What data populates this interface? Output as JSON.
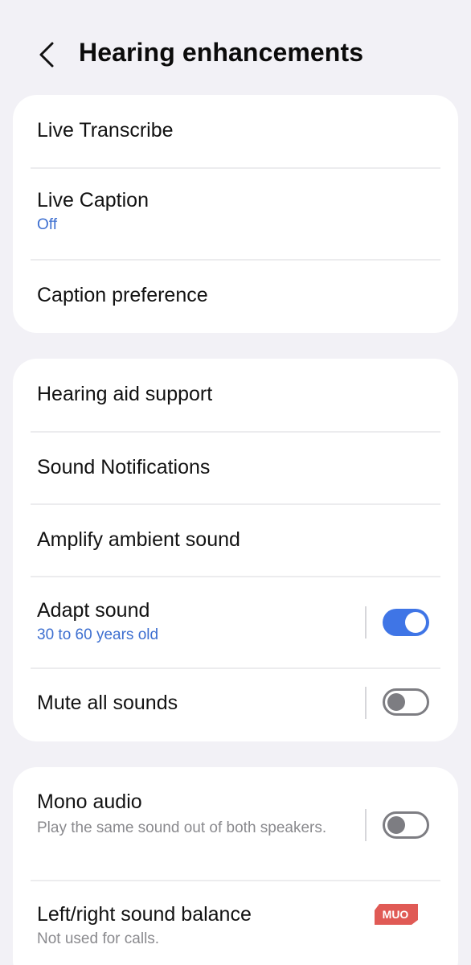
{
  "header": {
    "title": "Hearing enhancements",
    "back_icon": "chevron-left-icon"
  },
  "group1": {
    "live_transcribe": {
      "label": "Live Transcribe"
    },
    "live_caption": {
      "label": "Live Caption",
      "status": "Off"
    },
    "caption_preference": {
      "label": "Caption preference"
    }
  },
  "group2": {
    "hearing_aid_support": {
      "label": "Hearing aid support"
    },
    "sound_notifications": {
      "label": "Sound Notifications"
    },
    "amplify_ambient_sound": {
      "label": "Amplify ambient sound"
    },
    "adapt_sound": {
      "label": "Adapt sound",
      "status": "30 to 60 years old",
      "enabled": true
    },
    "mute_all_sounds": {
      "label": "Mute all sounds",
      "enabled": false
    }
  },
  "group3": {
    "mono_audio": {
      "label": "Mono audio",
      "description": "Play the same sound out of both speakers.",
      "enabled": false
    },
    "sound_balance": {
      "label": "Left/right sound balance",
      "description": "Not used for calls."
    }
  },
  "watermark": {
    "text": "MUO"
  },
  "colors": {
    "background": "#f2f1f6",
    "card": "#ffffff",
    "accent": "#3f75e6",
    "status_text": "#3d6fd0",
    "secondary_text": "#8a8a8e",
    "toggle_off": "#7d7d82"
  }
}
